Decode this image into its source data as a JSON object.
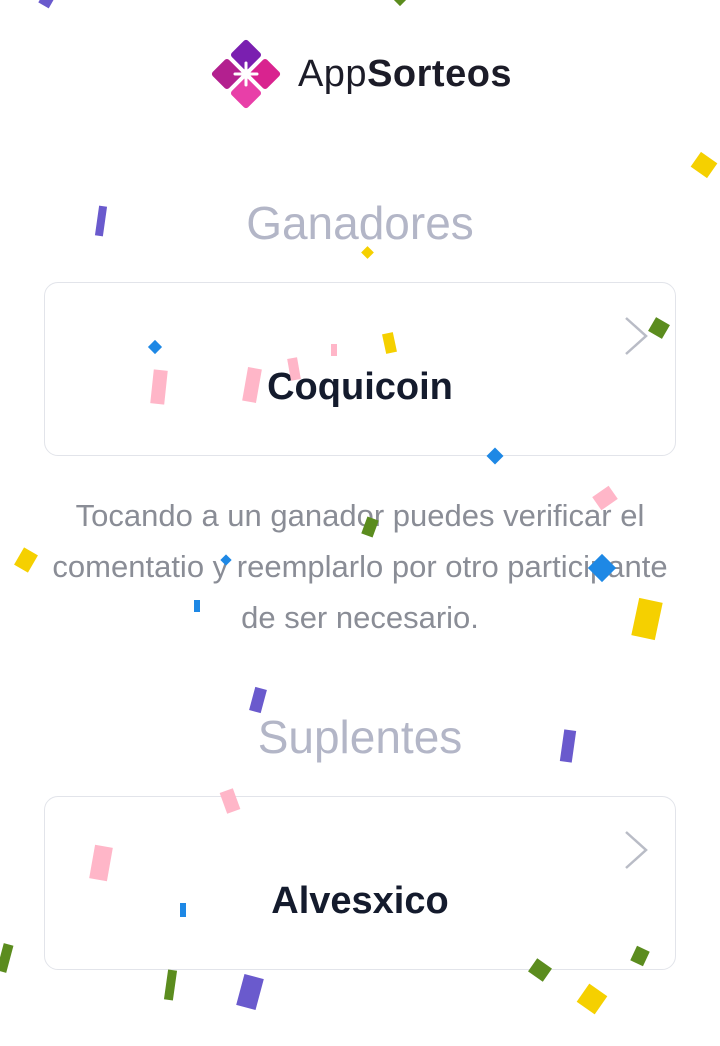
{
  "header": {
    "logo": "appsorteos-diamond-logo",
    "brand_part1": "App",
    "brand_part2": "Sorteos"
  },
  "winners": {
    "title": "Ganadores",
    "items": [
      {
        "name": "Coquicoin"
      }
    ]
  },
  "hint": {
    "text": "Tocando a un ganador puedes verificar el comentatio y reemplarlo por otro participante de ser necesario."
  },
  "substitutes": {
    "title": "Suplentes",
    "items": [
      {
        "name": "Alvesxico"
      }
    ]
  },
  "icons": {
    "card_chevron": "chevron-right-icon"
  },
  "colors": {
    "brand_magenta": "#c71f9f",
    "brand_purple": "#6b1fa8",
    "title_gray": "#b3b6c7",
    "text_gray": "#8a8d96",
    "name_dark": "#141b2d",
    "card_border": "#e2e4ea",
    "confetti": [
      "#6a5acd",
      "#f5d000",
      "#1e88e5",
      "#ffb6c8",
      "#5b8c1e"
    ]
  }
}
